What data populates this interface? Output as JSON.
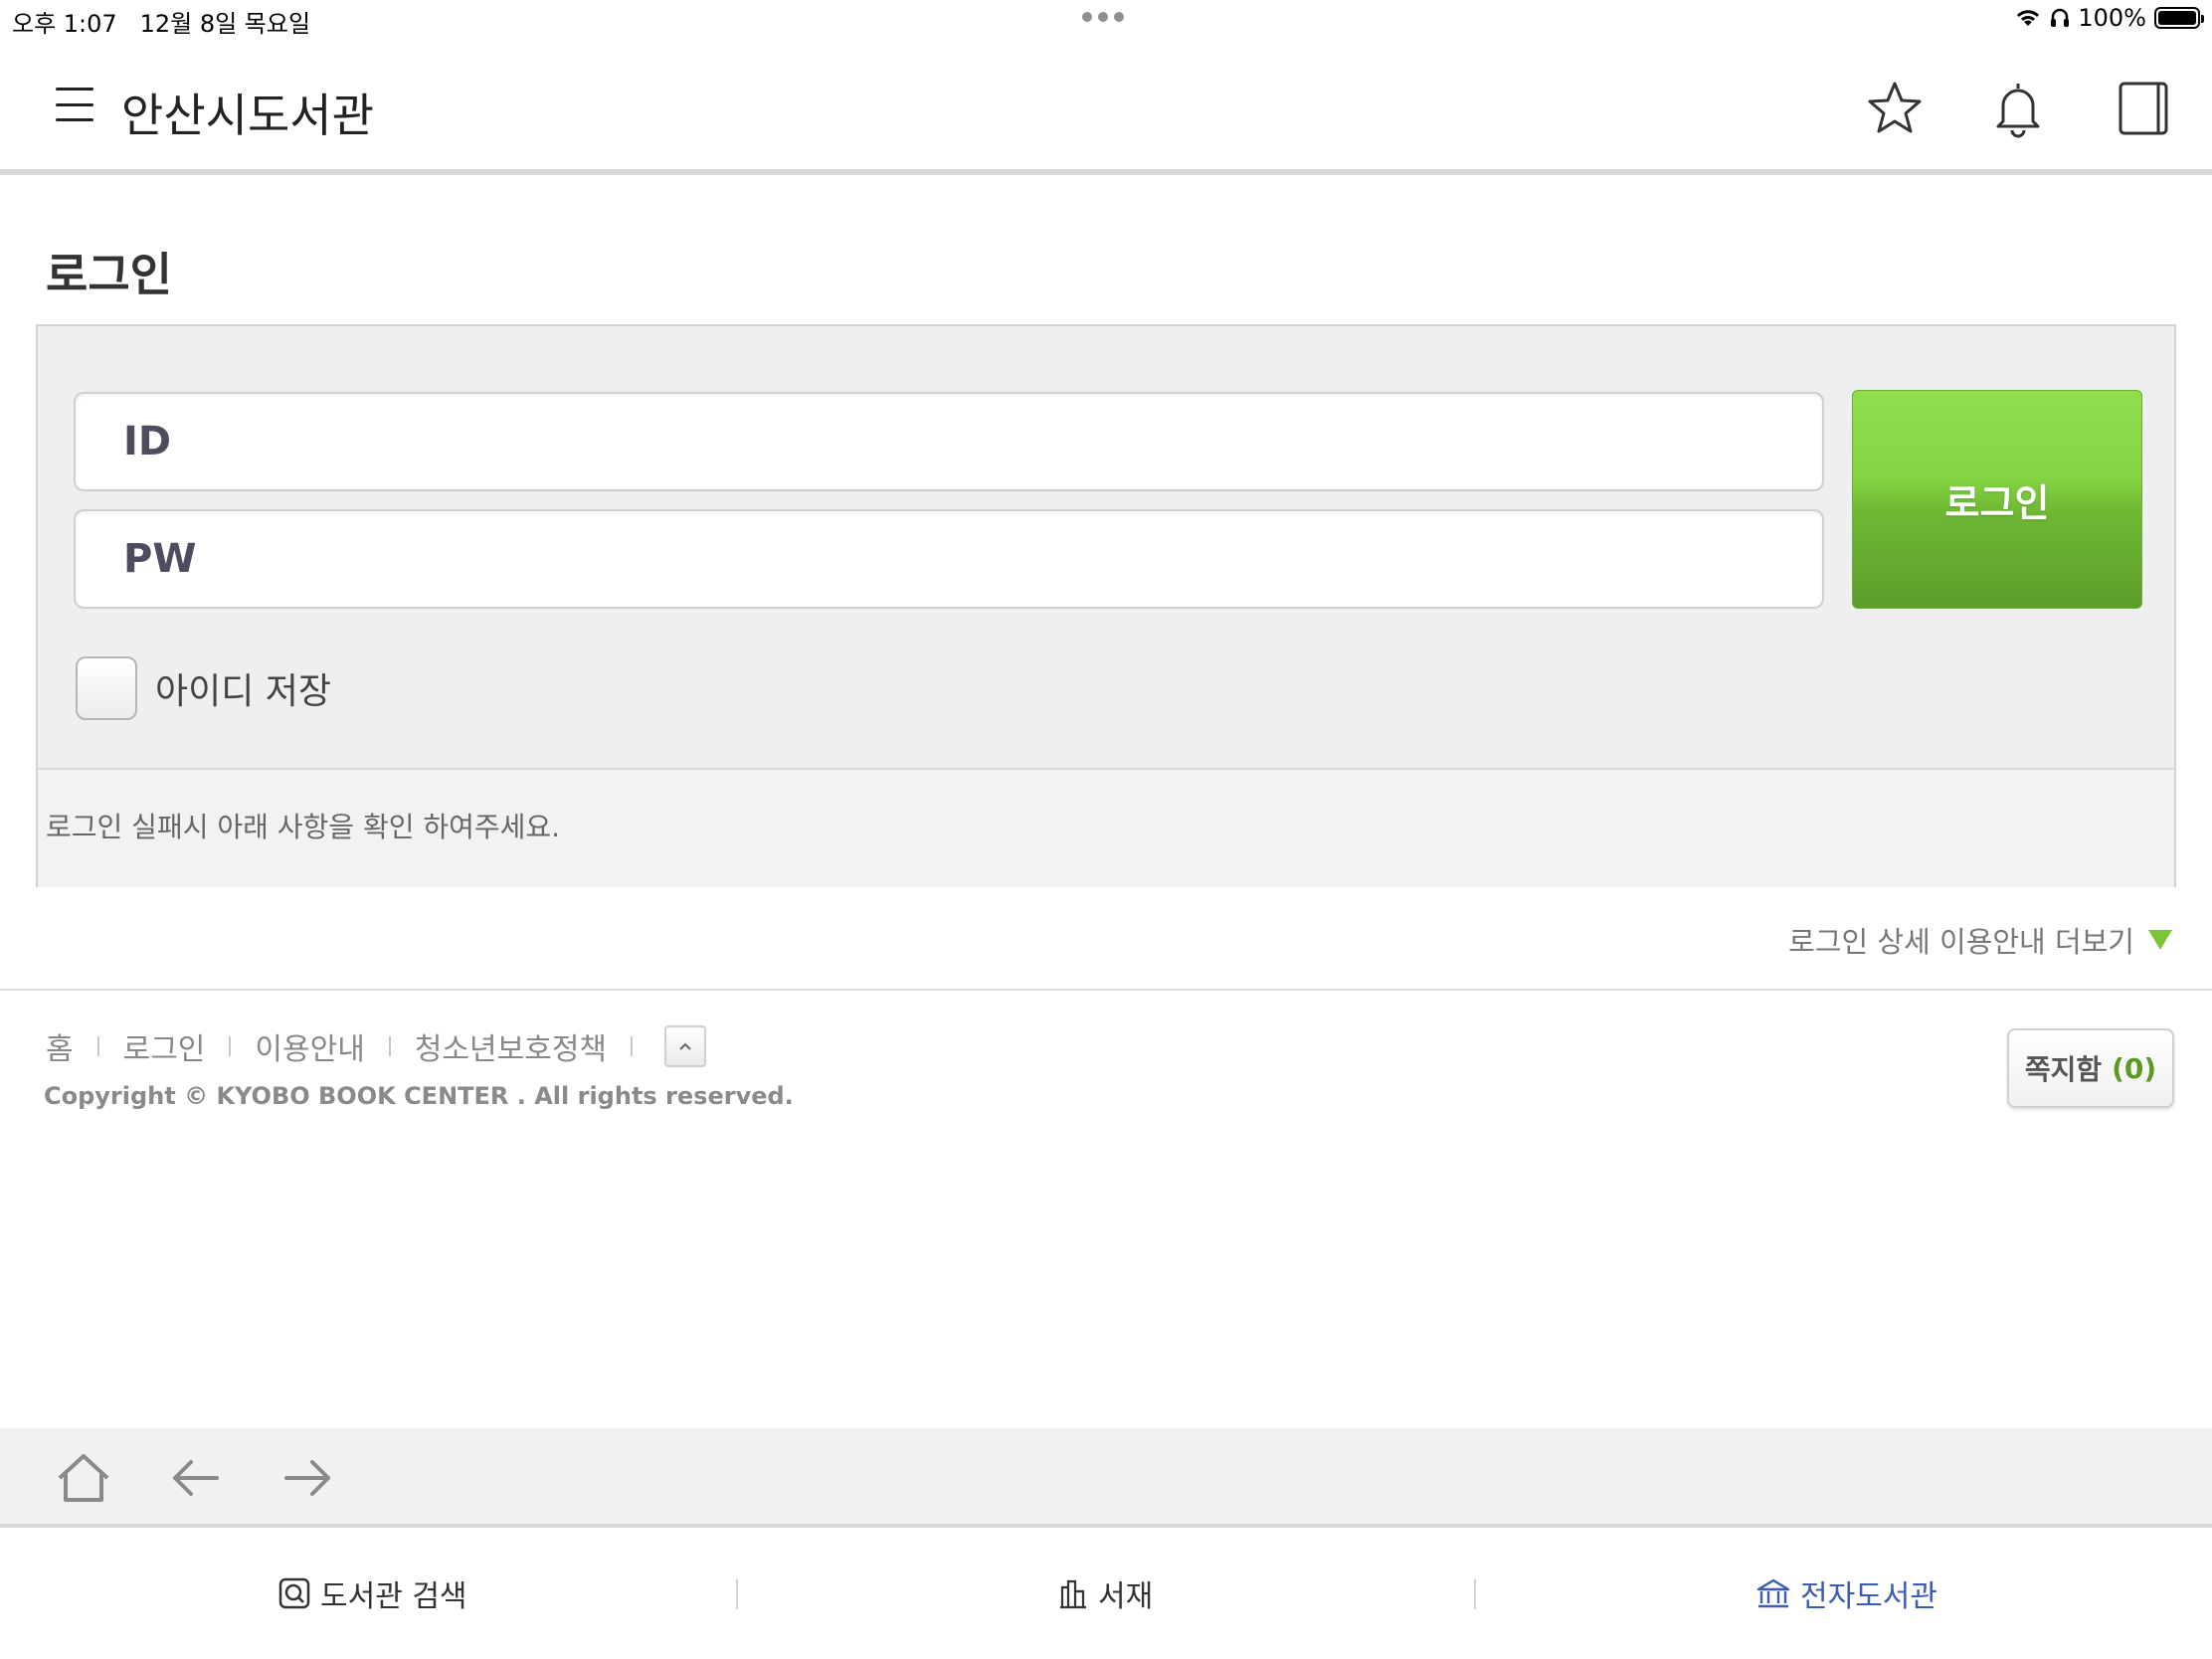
{
  "status_bar": {
    "time": "오후 1:07",
    "date": "12월 8일 목요일",
    "battery": "100%"
  },
  "app": {
    "title": "안산시도서관"
  },
  "login": {
    "page_title": "로그인",
    "id_placeholder": "ID",
    "pw_placeholder": "PW",
    "button_label": "로그인",
    "save_id_label": "아이디 저장",
    "save_id_checked": false,
    "notice": "로그인 실패시 아래 사항을 확인 하여주세요.",
    "more_guide": "로그인 상세 이용안내 더보기"
  },
  "footer": {
    "links": [
      "홈",
      "로그인",
      "이용안내",
      "청소년보호정책"
    ],
    "copyright": "Copyright © KYOBO BOOK CENTER . All rights reserved.",
    "message_box_label": "쪽지함",
    "message_count": "(0)"
  },
  "tabbar": {
    "tabs": [
      "도서관 검색",
      "서재",
      "전자도서관"
    ],
    "active_color": "#3c5bb5"
  },
  "colors": {
    "accent_green": "#7cc53a",
    "login_button": "#6fb934"
  }
}
